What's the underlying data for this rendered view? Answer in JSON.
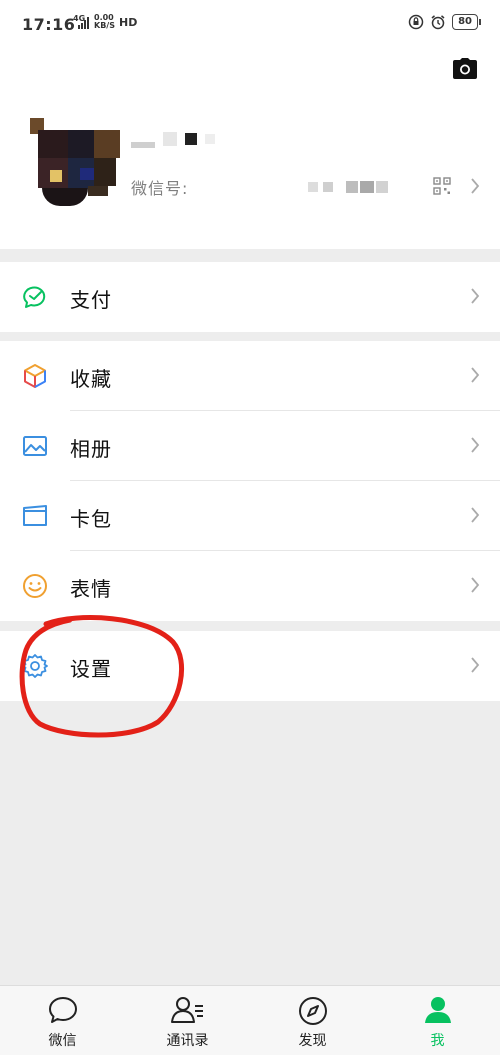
{
  "status_bar": {
    "time": "17:16",
    "network": "4G",
    "speed_value": "0.00",
    "speed_unit": "KB/S",
    "hd": "HD",
    "battery": "80"
  },
  "profile": {
    "wechat_id_label": "微信号:"
  },
  "menu": {
    "pay": "支付",
    "favorites": "收藏",
    "album": "相册",
    "cards": "卡包",
    "stickers": "表情",
    "settings": "设置"
  },
  "tabs": [
    {
      "label": "微信",
      "icon": "chat-bubble-icon"
    },
    {
      "label": "通讯录",
      "icon": "contacts-icon"
    },
    {
      "label": "发现",
      "icon": "compass-icon"
    },
    {
      "label": "我",
      "icon": "person-icon"
    }
  ],
  "colors": {
    "accent": "#07c160",
    "annotation": "#e32118",
    "background": "#ededed"
  }
}
